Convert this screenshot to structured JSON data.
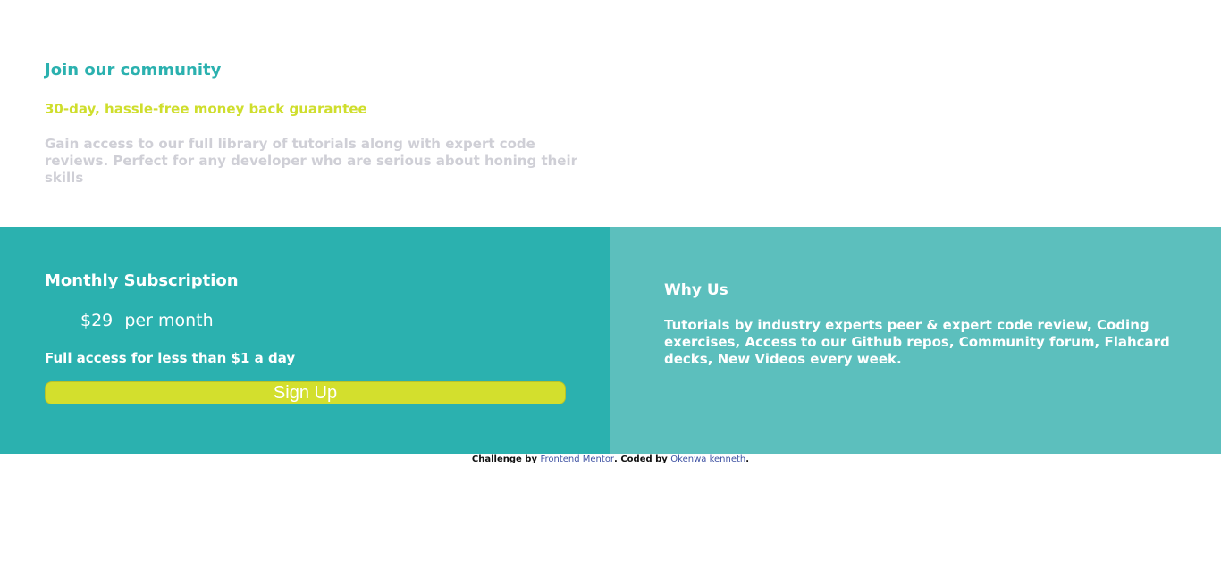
{
  "community": {
    "heading": "Join our community",
    "guarantee": "30-day, hassle-free money back guarantee",
    "description": "Gain access to our full library of tutorials along with expert code reviews. Perfect for any developer who are serious about honing their skills"
  },
  "subscription": {
    "title": "Monthly Subscription",
    "price": "$29",
    "period": "per month",
    "note": "Full access for less than $1 a day",
    "button_label": "Sign Up"
  },
  "why_us": {
    "title": "Why Us",
    "text": "Tutorials by industry experts peer & expert code review, Coding exercises, Access to our Github repos, Community forum, Flahcard decks, New Videos every week."
  },
  "attribution": {
    "prefix": "Challenge by ",
    "challenge_link": "Frontend Mentor",
    "middle": ". Coded by ",
    "author_link": "Okenwa kenneth",
    "suffix": "."
  },
  "colors": {
    "primary": "#2bb1af",
    "secondary": "#5cbfbd",
    "accent": "#d3df2d",
    "muted_text": "#cfcfd6"
  }
}
